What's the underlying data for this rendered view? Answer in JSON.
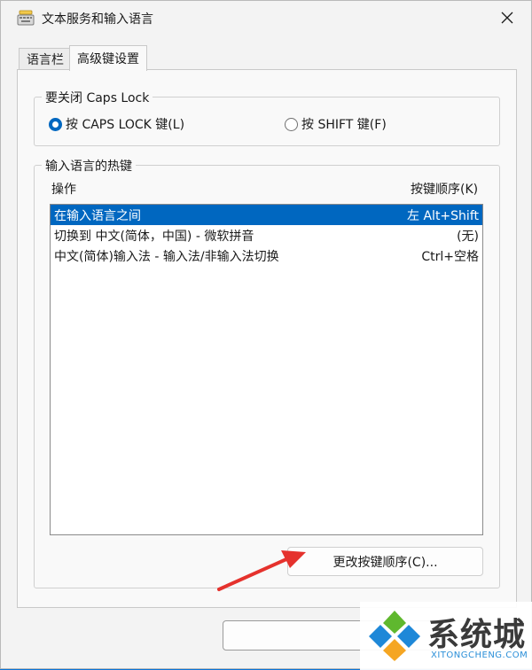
{
  "window": {
    "title": "文本服务和输入语言"
  },
  "tabs": [
    {
      "label": "语言栏",
      "active": false
    },
    {
      "label": "高级键设置",
      "active": true
    }
  ],
  "caps_lock": {
    "legend": "要关闭 Caps Lock",
    "options": [
      {
        "label": "按 CAPS LOCK 键(L)",
        "checked": true
      },
      {
        "label": "按 SHIFT 键(F)",
        "checked": false
      }
    ]
  },
  "hotkeys": {
    "legend": "输入语言的热键",
    "col_action": "操作",
    "col_sequence": "按键顺序(K)",
    "rows": [
      {
        "action": "在输入语言之间",
        "sequence": "左 Alt+Shift",
        "selected": true
      },
      {
        "action": "切换到 中文(简体，中国) - 微软拼音",
        "sequence": "(无)",
        "selected": false
      },
      {
        "action": "中文(简体)输入法 - 输入法/非输入法切换",
        "sequence": "Ctrl+空格",
        "selected": false
      }
    ],
    "change_button": "更改按键顺序(C)..."
  },
  "watermark": {
    "cn": "系统城",
    "en": "XITONGCHENG.COM"
  },
  "colors": {
    "accent": "#0067c0",
    "annotation_arrow": "#e5322d"
  }
}
